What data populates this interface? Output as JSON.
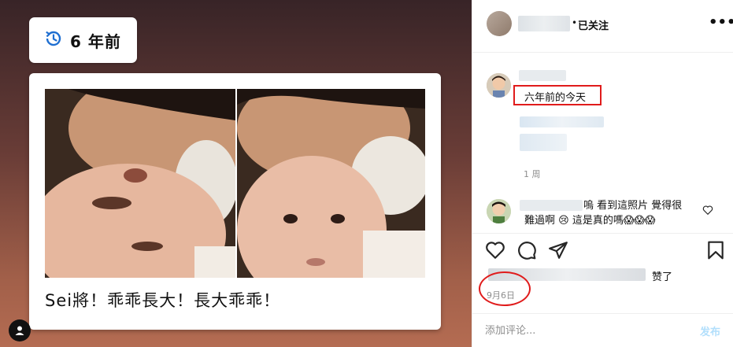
{
  "memory_badge": {
    "icon": "history-clock-icon",
    "label": "6 年前"
  },
  "post": {
    "caption": "Sei將！乖乖長大！長大乖乖！"
  },
  "header": {
    "separator": "•",
    "follow_status": "已关注",
    "more_icon": "more-horizontal-icon",
    "more_label": "•••"
  },
  "caption_block": {
    "highlight_text": "六年前的今天",
    "time_ago": "1 周"
  },
  "comment": {
    "text_line1": "嗚 看到這照片 覺得很",
    "text_line2": "難過啊 😢 這是真的嗎😱😱😱",
    "like_icon": "heart-outline-icon"
  },
  "actions": {
    "like_icon": "heart-icon",
    "comment_icon": "comment-bubble-icon",
    "share_icon": "paper-plane-icon",
    "save_icon": "bookmark-icon"
  },
  "likes": {
    "suffix": "赞了"
  },
  "date": "9月6日",
  "add_comment": {
    "placeholder": "添加评论...",
    "post_label": "发布"
  },
  "colors": {
    "annotation_red": "#e01b1b",
    "post_button_disabled": "#b2dffc",
    "muted_text": "#8e8e8e"
  }
}
